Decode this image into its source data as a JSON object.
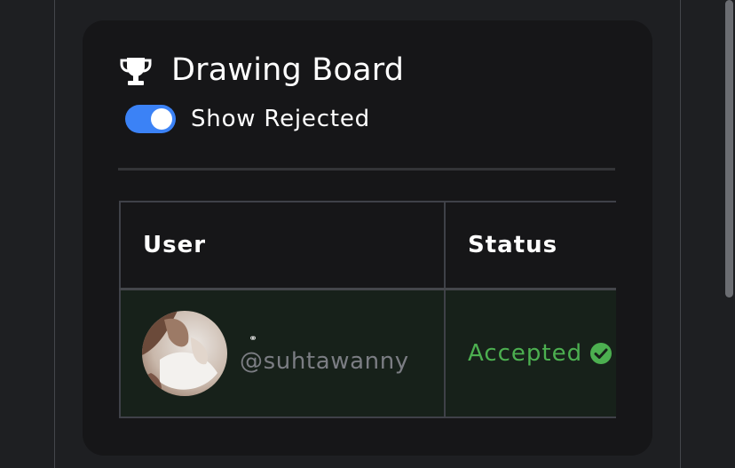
{
  "card": {
    "title": "Drawing Board",
    "title_icon": "trophy-icon",
    "toggle": {
      "label": "Show Rejected",
      "checked": true,
      "color": "#3b82f6"
    }
  },
  "table": {
    "columns": [
      "User",
      "Status"
    ],
    "rows": [
      {
        "avatar": "user-avatar",
        "display_name": "⚭",
        "handle": "@suhtawanny",
        "status": "Accepted",
        "status_icon": "check-circle-icon",
        "status_color": "#4caf50",
        "row_color": "#17211a"
      }
    ]
  }
}
